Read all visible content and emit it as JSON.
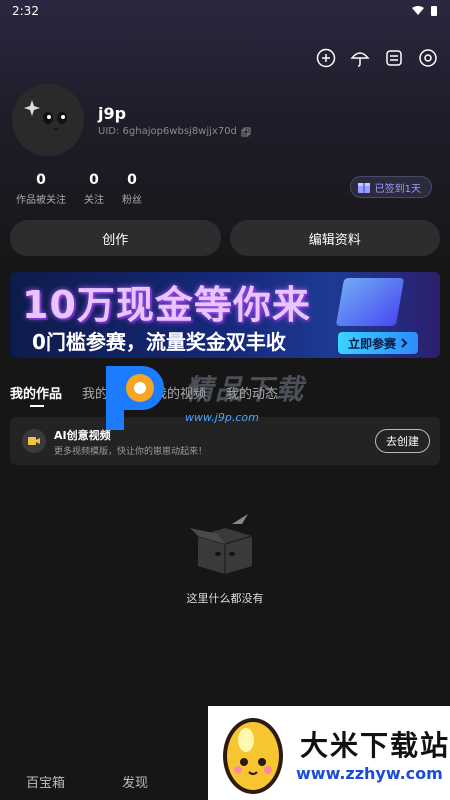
{
  "status_bar": {
    "time": "2:32"
  },
  "profile": {
    "username": "j9p",
    "uid": "UID: 6ghajop6wbsj8wjjx70d",
    "stats": [
      {
        "value": "0",
        "label": "作品被关注"
      },
      {
        "value": "0",
        "label": "关注"
      },
      {
        "value": "0",
        "label": "粉丝"
      }
    ],
    "checkin_label": "已签到1天"
  },
  "actions": {
    "create": "创作",
    "edit_profile": "编辑资料"
  },
  "banner": {
    "title": "10万现金等你来",
    "subtitle": "0门槛参赛，流量奖金双丰收",
    "cta": "立即参赛"
  },
  "tabs": [
    {
      "label": "我的作品"
    },
    {
      "label": "我的草稿"
    },
    {
      "label": "我的视频"
    },
    {
      "label": "我的动态"
    }
  ],
  "ai_card": {
    "title": "AI创意视频",
    "desc": "更多视频模版，快让你的崽崽动起来！",
    "button": "去创建"
  },
  "empty": {
    "text": "这里什么都没有"
  },
  "watermark": {
    "text": "精品下载",
    "url": "www.j9p.com"
  },
  "bottom_nav": [
    {
      "label": "百宝箱"
    },
    {
      "label": "发现"
    }
  ],
  "corner_logo": {
    "text": "大米下载站",
    "url": "www.zzhyw.com"
  },
  "colors": {
    "accent": "#9a9cff",
    "background": "#161616",
    "card": "#232323"
  }
}
